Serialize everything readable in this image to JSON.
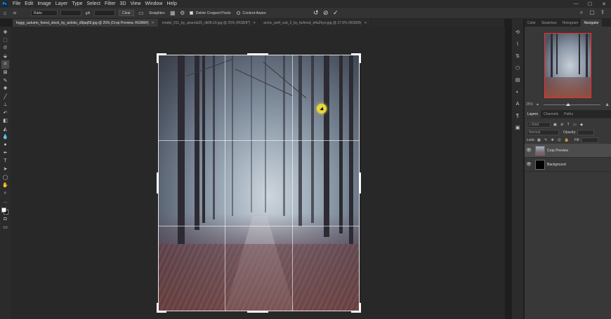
{
  "menu": {
    "logo": "Ps",
    "items": [
      "File",
      "Edit",
      "Image",
      "Layer",
      "Type",
      "Select",
      "Filter",
      "3D",
      "View",
      "Window",
      "Help"
    ],
    "window_controls": [
      "—",
      "☐",
      "✕"
    ]
  },
  "options_bar": {
    "ratio_label": "Ratio",
    "clear_label": "Clear",
    "straighten_label": "Straighten",
    "delete_cropped_label": "Delete Cropped Pixels",
    "content_aware_label": "Content-Aware"
  },
  "tabs": [
    {
      "label": "foggy_autumn_forest_stock_by_aoloko_d9jaq56.jpg @ 25% (Crop Preview, RGB/8#)",
      "active": true
    },
    {
      "label": "model_011_by_anunda25_dk0fc19.jpg @ 25% (RGB/8*)",
      "active": false
    },
    {
      "label": "arctic_wolf_cub_2_by_furlined_d4a2hyo.jpg @ 27.6% (RGB/8)",
      "active": false
    }
  ],
  "panels": {
    "top_tabs": [
      "Color",
      "Swatches",
      "Histogram",
      "Navigator"
    ],
    "active_top_tab": "Navigator",
    "zoom_value": "25%",
    "layers_tabs": [
      "Layers",
      "Channels",
      "Paths"
    ],
    "active_layers_tab": "Layers",
    "kind_label": "Kind",
    "blend_mode": "Normal",
    "opacity_label": "Opacity:",
    "lock_label": "Lock:",
    "fill_label": "Fill:",
    "layers": [
      {
        "name": "Crop Preview",
        "selected": true
      },
      {
        "name": "Background",
        "selected": false
      }
    ]
  }
}
